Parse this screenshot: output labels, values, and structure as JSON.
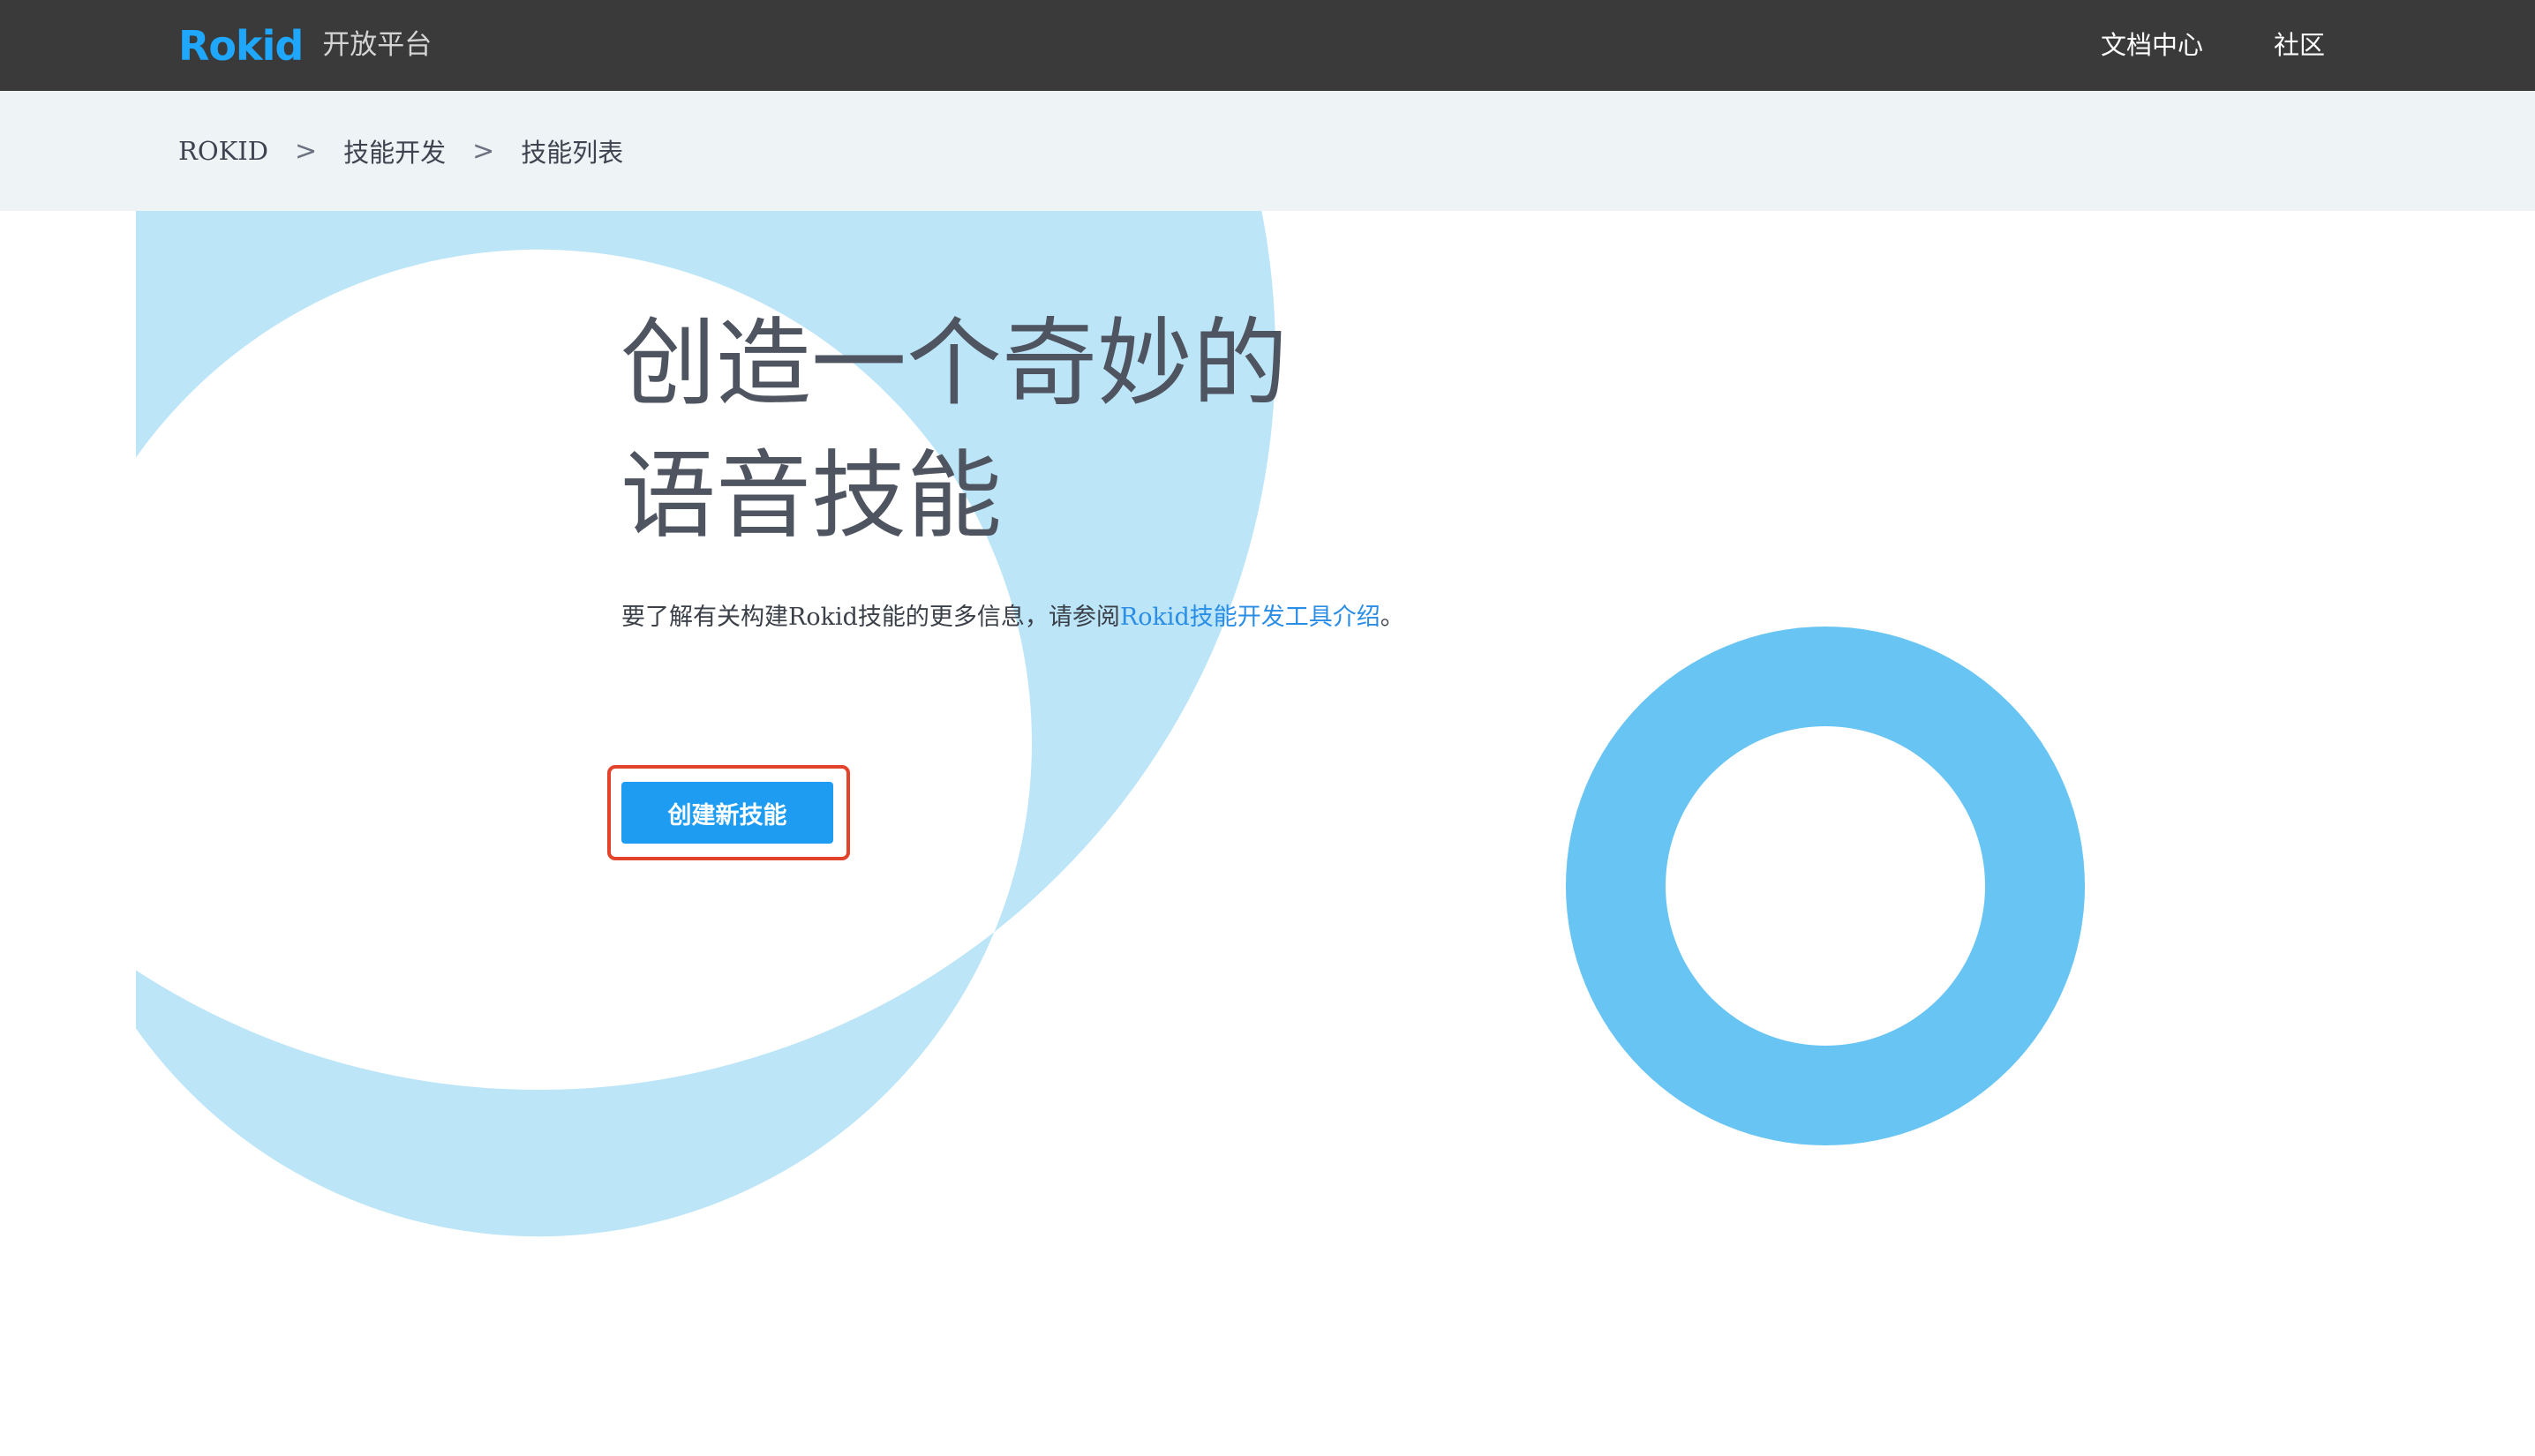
{
  "header": {
    "logo": "Rokid",
    "platform_label": "开放平台",
    "links": [
      {
        "label": "文档中心"
      },
      {
        "label": "社区"
      }
    ]
  },
  "breadcrumb": {
    "items": [
      {
        "label": "ROKID"
      },
      {
        "label": "技能开发"
      },
      {
        "label": "技能列表"
      }
    ],
    "separator": ">"
  },
  "hero": {
    "title_line1": "创造一个奇妙的",
    "title_line2": "语音技能",
    "description_prefix": "要了解有关构建Rokid技能的更多信息，请参阅",
    "description_link": "Rokid技能开发工具介绍",
    "description_suffix": "。"
  },
  "cta": {
    "label": "创建新技能"
  },
  "colors": {
    "topbar": "#3a3a3a",
    "brand": "#1ea7fd",
    "breadcrumb_bg": "#eef3f6",
    "ring_light": "#bce5f8",
    "ring_strong": "#68c4f3",
    "button": "#1e9cf2",
    "highlight": "#e2432a",
    "link": "#2a8de6"
  }
}
